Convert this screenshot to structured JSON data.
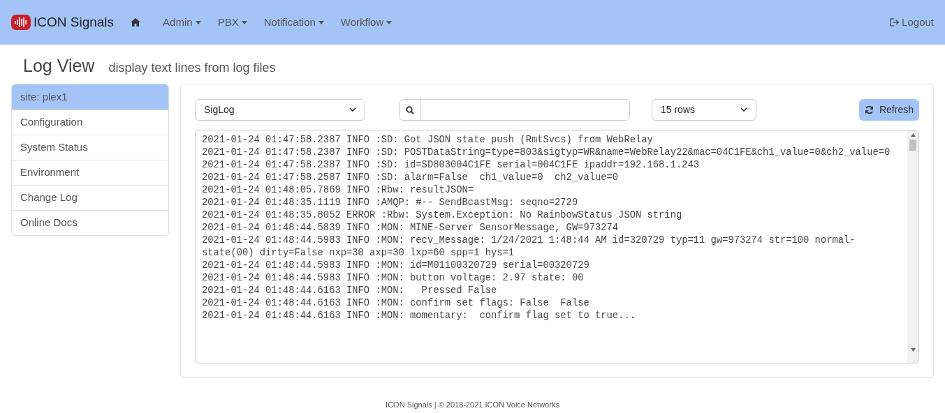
{
  "navbar": {
    "brand": "ICON Signals",
    "menus": [
      {
        "label": "Admin"
      },
      {
        "label": "PBX"
      },
      {
        "label": "Notification"
      },
      {
        "label": "Workflow"
      }
    ],
    "logout": "Logout"
  },
  "header": {
    "title": "Log View",
    "subtitle": "display text lines from log files"
  },
  "sidebar": {
    "items": [
      {
        "label": "site: plex1",
        "selected": true
      },
      {
        "label": "Configuration",
        "selected": false
      },
      {
        "label": "System Status",
        "selected": false
      },
      {
        "label": "Environment",
        "selected": false
      },
      {
        "label": "Change Log",
        "selected": false
      },
      {
        "label": "Online Docs",
        "selected": false
      }
    ]
  },
  "controls": {
    "log_select": "SigLog",
    "rows_select": "15 rows",
    "refresh": "Refresh"
  },
  "log_lines": [
    "2021-01-24 01:47:58.2387 INFO :SD: Got JSON state push (RmtSvcs) from WebRelay",
    "2021-01-24 01:47:58.2387 INFO :SD: POSTDataString=type=803&sigtyp=WR&name=WebRelay22&mac=04C1FE&ch1_value=0&ch2_value=0",
    "2021-01-24 01:47:58.2387 INFO :SD: id=SD803004C1FE serial=004C1FE ipaddr=192.168.1.243",
    "2021-01-24 01:47:58.2587 INFO :SD: alarm=False  ch1_value=0  ch2_value=0",
    "2021-01-24 01:48:05.7869 INFO :Rbw: resultJSON=",
    "2021-01-24 01:48:35.1119 INFO :AMQP: #-- SendBcastMsg: seqno=2729",
    "2021-01-24 01:48:35.8052 ERROR :Rbw: System.Exception: No RainbowStatus JSON string",
    "2021-01-24 01:48:44.5839 INFO :MON: MINE-Server SensorMessage, GW=973274",
    "2021-01-24 01:48:44.5983 INFO :MON: recv_Message: 1/24/2021 1:48:44 AM id=320729 typ=11 gw=973274 str=100 normal-state(00) dirty=False nxp=30 axp=30 lxp=60 spp=1 hys=1",
    "2021-01-24 01:48:44.5983 INFO :MON: id=M01100320729 serial=00320729",
    "2021-01-24 01:48:44.5983 INFO :MON: button voltage: 2.97 state: 00",
    "2021-01-24 01:48:44.6163 INFO :MON:   Pressed False",
    "2021-01-24 01:48:44.6163 INFO :MON: confirm set flags: False  False",
    "2021-01-24 01:48:44.6163 INFO :MON: momentary:  confirm flag set to true..."
  ],
  "footer": "ICON Signals | © 2018-2021 ICON Voice Networks"
}
